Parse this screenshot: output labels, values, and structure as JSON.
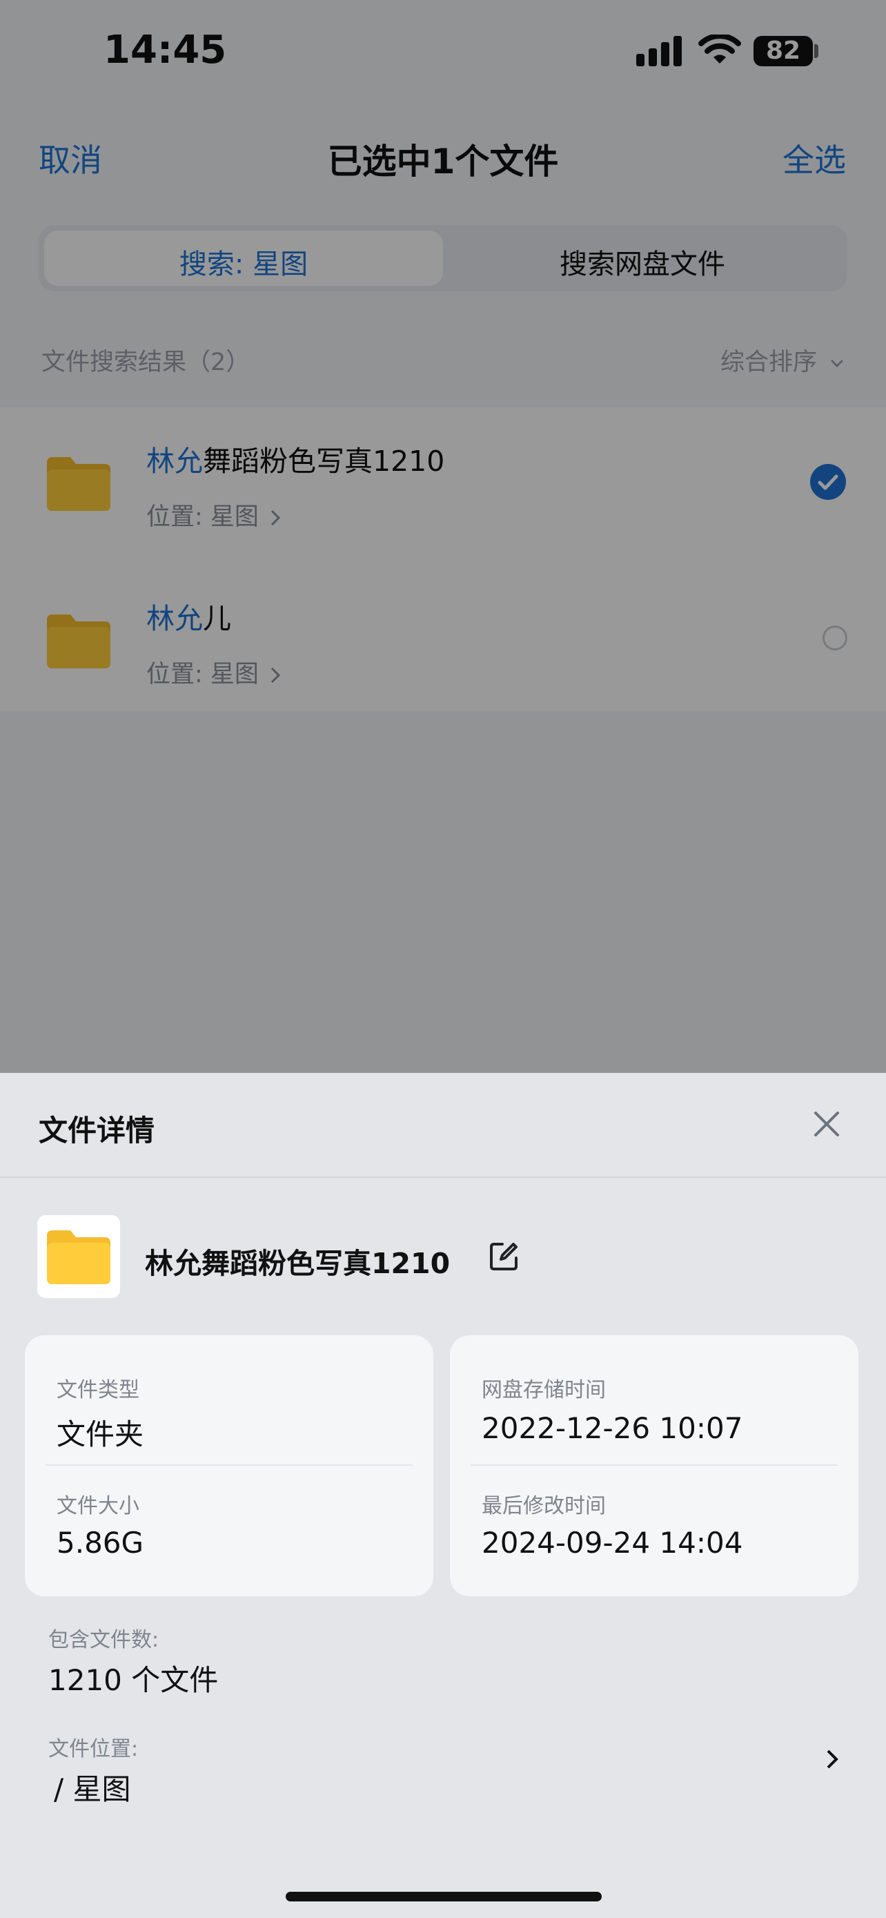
{
  "status_bar": {
    "time": "14:45",
    "battery": "82"
  },
  "header": {
    "cancel": "取消",
    "title": "已选中1个文件",
    "select_all": "全选"
  },
  "segments": {
    "active": "搜索: 星图",
    "inactive": "搜索网盘文件"
  },
  "results": {
    "title": "文件搜索结果（2）",
    "sort": "综合排序"
  },
  "list": [
    {
      "highlight": "林允",
      "rest": "舞蹈粉色写真1210",
      "location": "位置:  星图",
      "selected": true
    },
    {
      "highlight": "林允",
      "rest": "儿",
      "location": "位置:  星图",
      "selected": false
    }
  ],
  "sheet": {
    "title": "文件详情",
    "name": "林允舞蹈粉色写真1210",
    "left_card": {
      "type_label": "文件类型",
      "type_value": "文件夹",
      "size_label": "文件大小",
      "size_value": "5.86G"
    },
    "right_card": {
      "stored_label": "网盘存储时间",
      "stored_value": "2022-12-26 10:07",
      "modified_label": "最后修改时间",
      "modified_value": "2024-09-24 14:04"
    },
    "count_label": "包含文件数:",
    "count_value": "1210 个文件",
    "location_label": "文件位置:",
    "location_value": "/ 星图"
  },
  "colors": {
    "accent": "#1f73d6",
    "folder": "#f5bd2e"
  }
}
